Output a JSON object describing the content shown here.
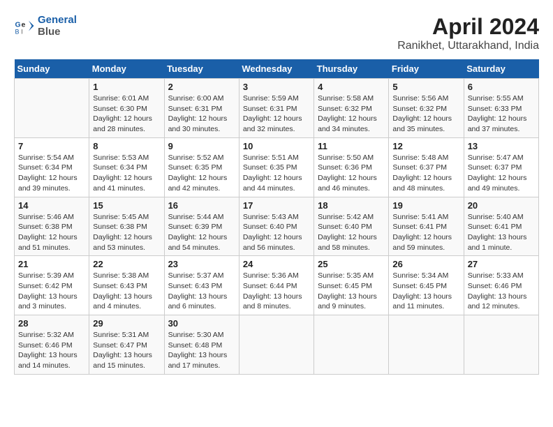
{
  "header": {
    "logo_line1": "General",
    "logo_line2": "Blue",
    "title": "April 2024",
    "subtitle": "Ranikhet, Uttarakhand, India"
  },
  "calendar": {
    "days_of_week": [
      "Sunday",
      "Monday",
      "Tuesday",
      "Wednesday",
      "Thursday",
      "Friday",
      "Saturday"
    ],
    "weeks": [
      [
        {
          "num": "",
          "info": ""
        },
        {
          "num": "1",
          "info": "Sunrise: 6:01 AM\nSunset: 6:30 PM\nDaylight: 12 hours\nand 28 minutes."
        },
        {
          "num": "2",
          "info": "Sunrise: 6:00 AM\nSunset: 6:31 PM\nDaylight: 12 hours\nand 30 minutes."
        },
        {
          "num": "3",
          "info": "Sunrise: 5:59 AM\nSunset: 6:31 PM\nDaylight: 12 hours\nand 32 minutes."
        },
        {
          "num": "4",
          "info": "Sunrise: 5:58 AM\nSunset: 6:32 PM\nDaylight: 12 hours\nand 34 minutes."
        },
        {
          "num": "5",
          "info": "Sunrise: 5:56 AM\nSunset: 6:32 PM\nDaylight: 12 hours\nand 35 minutes."
        },
        {
          "num": "6",
          "info": "Sunrise: 5:55 AM\nSunset: 6:33 PM\nDaylight: 12 hours\nand 37 minutes."
        }
      ],
      [
        {
          "num": "7",
          "info": "Sunrise: 5:54 AM\nSunset: 6:34 PM\nDaylight: 12 hours\nand 39 minutes."
        },
        {
          "num": "8",
          "info": "Sunrise: 5:53 AM\nSunset: 6:34 PM\nDaylight: 12 hours\nand 41 minutes."
        },
        {
          "num": "9",
          "info": "Sunrise: 5:52 AM\nSunset: 6:35 PM\nDaylight: 12 hours\nand 42 minutes."
        },
        {
          "num": "10",
          "info": "Sunrise: 5:51 AM\nSunset: 6:35 PM\nDaylight: 12 hours\nand 44 minutes."
        },
        {
          "num": "11",
          "info": "Sunrise: 5:50 AM\nSunset: 6:36 PM\nDaylight: 12 hours\nand 46 minutes."
        },
        {
          "num": "12",
          "info": "Sunrise: 5:48 AM\nSunset: 6:37 PM\nDaylight: 12 hours\nand 48 minutes."
        },
        {
          "num": "13",
          "info": "Sunrise: 5:47 AM\nSunset: 6:37 PM\nDaylight: 12 hours\nand 49 minutes."
        }
      ],
      [
        {
          "num": "14",
          "info": "Sunrise: 5:46 AM\nSunset: 6:38 PM\nDaylight: 12 hours\nand 51 minutes."
        },
        {
          "num": "15",
          "info": "Sunrise: 5:45 AM\nSunset: 6:38 PM\nDaylight: 12 hours\nand 53 minutes."
        },
        {
          "num": "16",
          "info": "Sunrise: 5:44 AM\nSunset: 6:39 PM\nDaylight: 12 hours\nand 54 minutes."
        },
        {
          "num": "17",
          "info": "Sunrise: 5:43 AM\nSunset: 6:40 PM\nDaylight: 12 hours\nand 56 minutes."
        },
        {
          "num": "18",
          "info": "Sunrise: 5:42 AM\nSunset: 6:40 PM\nDaylight: 12 hours\nand 58 minutes."
        },
        {
          "num": "19",
          "info": "Sunrise: 5:41 AM\nSunset: 6:41 PM\nDaylight: 12 hours\nand 59 minutes."
        },
        {
          "num": "20",
          "info": "Sunrise: 5:40 AM\nSunset: 6:41 PM\nDaylight: 13 hours\nand 1 minute."
        }
      ],
      [
        {
          "num": "21",
          "info": "Sunrise: 5:39 AM\nSunset: 6:42 PM\nDaylight: 13 hours\nand 3 minutes."
        },
        {
          "num": "22",
          "info": "Sunrise: 5:38 AM\nSunset: 6:43 PM\nDaylight: 13 hours\nand 4 minutes."
        },
        {
          "num": "23",
          "info": "Sunrise: 5:37 AM\nSunset: 6:43 PM\nDaylight: 13 hours\nand 6 minutes."
        },
        {
          "num": "24",
          "info": "Sunrise: 5:36 AM\nSunset: 6:44 PM\nDaylight: 13 hours\nand 8 minutes."
        },
        {
          "num": "25",
          "info": "Sunrise: 5:35 AM\nSunset: 6:45 PM\nDaylight: 13 hours\nand 9 minutes."
        },
        {
          "num": "26",
          "info": "Sunrise: 5:34 AM\nSunset: 6:45 PM\nDaylight: 13 hours\nand 11 minutes."
        },
        {
          "num": "27",
          "info": "Sunrise: 5:33 AM\nSunset: 6:46 PM\nDaylight: 13 hours\nand 12 minutes."
        }
      ],
      [
        {
          "num": "28",
          "info": "Sunrise: 5:32 AM\nSunset: 6:46 PM\nDaylight: 13 hours\nand 14 minutes."
        },
        {
          "num": "29",
          "info": "Sunrise: 5:31 AM\nSunset: 6:47 PM\nDaylight: 13 hours\nand 15 minutes."
        },
        {
          "num": "30",
          "info": "Sunrise: 5:30 AM\nSunset: 6:48 PM\nDaylight: 13 hours\nand 17 minutes."
        },
        {
          "num": "",
          "info": ""
        },
        {
          "num": "",
          "info": ""
        },
        {
          "num": "",
          "info": ""
        },
        {
          "num": "",
          "info": ""
        }
      ]
    ]
  }
}
